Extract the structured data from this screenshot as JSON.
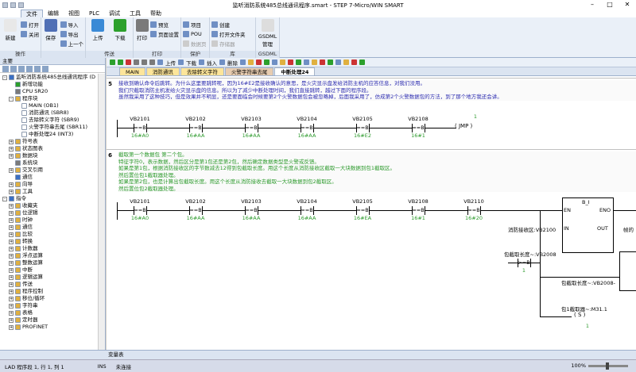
{
  "window": {
    "title": "监听消防系统485总线通讯程序.smart - STEP 7-Micro/WIN SMART",
    "controls": {
      "min": "–",
      "max": "□",
      "close": "✕"
    }
  },
  "menu": {
    "items": [
      "文件",
      "编辑",
      "视图",
      "PLC",
      "调试",
      "工具",
      "帮助"
    ],
    "active": 0
  },
  "ribbon": {
    "groups": [
      {
        "label": "操作",
        "big": [
          {
            "label": "新建",
            "icon": "new-icon",
            "color": "#e8e8e8"
          }
        ],
        "small": [
          {
            "label": "打开",
            "icon": "open-icon"
          },
          {
            "label": "关闭",
            "icon": "close-file-icon"
          }
        ]
      },
      {
        "label": "",
        "big": [
          {
            "label": "保存",
            "icon": "save-icon",
            "color": "#4f6fb5"
          }
        ],
        "small": [
          {
            "label": "导入",
            "icon": "import-icon"
          },
          {
            "label": "导出",
            "icon": "export-icon"
          },
          {
            "label": "上一个",
            "icon": "previous-icon"
          }
        ]
      },
      {
        "label": "传送",
        "big": [
          {
            "label": "上传",
            "icon": "upload-icon",
            "color": "#3a8ad6"
          },
          {
            "label": "下载",
            "icon": "download-icon",
            "color": "#2ca02c"
          }
        ],
        "small": []
      },
      {
        "label": "打印",
        "big": [
          {
            "label": "打印",
            "icon": "print-icon",
            "color": "#7a7a7a"
          }
        ],
        "small": [
          {
            "label": "预览",
            "icon": "preview-icon"
          },
          {
            "label": "页面设置",
            "icon": "page-setup-icon"
          }
        ]
      },
      {
        "label": "保护",
        "big": [],
        "small": [
          {
            "label": "项目",
            "icon": "project-icon"
          },
          {
            "label": "POU",
            "icon": "pou-icon"
          },
          {
            "label": "数据页",
            "icon": "data-page-icon",
            "disabled": true
          }
        ]
      },
      {
        "label": "库",
        "big": [],
        "small": [
          {
            "label": "创建",
            "icon": "create-icon"
          },
          {
            "label": "打开文件夹",
            "icon": "open-folder-icon"
          },
          {
            "label": "存储器",
            "icon": "memory-icon",
            "disabled": true
          }
        ]
      },
      {
        "label": "GSDML",
        "big": [
          {
            "label": "GSDML 管理",
            "icon": "gsdml-icon",
            "color": "#dddddd"
          }
        ],
        "small": []
      }
    ]
  },
  "left": {
    "header": "主要",
    "tree": [
      {
        "label": "监听消防系统485总线通讯程序 (D",
        "level": 0,
        "exp": "-",
        "color": "#3a6fc4"
      },
      {
        "label": "新增功能",
        "level": 1,
        "exp": "",
        "color": "#2ca02c"
      },
      {
        "label": "CPU SR20",
        "level": 1,
        "exp": "",
        "color": "#7a7a7a"
      },
      {
        "label": "程序块",
        "level": 1,
        "exp": "-",
        "color": "#e0b040"
      },
      {
        "label": "MAIN (OB1)",
        "level": 2,
        "exp": "",
        "color": "#ffffff"
      },
      {
        "label": "消防通讯 (SBR8)",
        "level": 2,
        "exp": "",
        "color": "#ffffff"
      },
      {
        "label": "去除转义字符 (SBR9)",
        "level": 2,
        "exp": "",
        "color": "#ffffff"
      },
      {
        "label": "火警字符串去尾 (SBR11)",
        "level": 2,
        "exp": "",
        "color": "#ffffff"
      },
      {
        "label": "中断处理24 (INT3)",
        "level": 2,
        "exp": "",
        "color": "#ffffff"
      },
      {
        "label": "符号表",
        "level": 1,
        "exp": "+",
        "color": "#e0b040"
      },
      {
        "label": "状态图表",
        "level": 1,
        "exp": "+",
        "color": "#e0b040"
      },
      {
        "label": "数据块",
        "level": 1,
        "exp": "+",
        "color": "#e0b040"
      },
      {
        "label": "系统块",
        "level": 1,
        "exp": "",
        "color": "#7a7a7a"
      },
      {
        "label": "交叉引用",
        "level": 1,
        "exp": "+",
        "color": "#e0b040"
      },
      {
        "label": "通信",
        "level": 1,
        "exp": "",
        "color": "#3a6fc4"
      },
      {
        "label": "向导",
        "level": 1,
        "exp": "+",
        "color": "#e0b040"
      },
      {
        "label": "工具",
        "level": 1,
        "exp": "+",
        "color": "#e0b040"
      },
      {
        "label": "指令",
        "level": 0,
        "exp": "-",
        "color": "#3a6fc4"
      },
      {
        "label": "收藏夹",
        "level": 1,
        "exp": "+",
        "color": "#e0b040"
      },
      {
        "label": "位逻辑",
        "level": 1,
        "exp": "+",
        "color": "#e0b040"
      },
      {
        "label": "时钟",
        "level": 1,
        "exp": "+",
        "color": "#e0b040"
      },
      {
        "label": "通信",
        "level": 1,
        "exp": "+",
        "color": "#e0b040"
      },
      {
        "label": "比较",
        "level": 1,
        "exp": "+",
        "color": "#e0b040"
      },
      {
        "label": "转换",
        "level": 1,
        "exp": "+",
        "color": "#e0b040"
      },
      {
        "label": "计数器",
        "level": 1,
        "exp": "+",
        "color": "#e0b040"
      },
      {
        "label": "浮点运算",
        "level": 1,
        "exp": "+",
        "color": "#e0b040"
      },
      {
        "label": "整数运算",
        "level": 1,
        "exp": "+",
        "color": "#e0b040"
      },
      {
        "label": "中断",
        "level": 1,
        "exp": "+",
        "color": "#e0b040"
      },
      {
        "label": "逻辑运算",
        "level": 1,
        "exp": "+",
        "color": "#e0b040"
      },
      {
        "label": "传送",
        "level": 1,
        "exp": "+",
        "color": "#e0b040"
      },
      {
        "label": "程序控制",
        "level": 1,
        "exp": "+",
        "color": "#e0b040"
      },
      {
        "label": "移位/循环",
        "level": 1,
        "exp": "+",
        "color": "#e0b040"
      },
      {
        "label": "字符串",
        "level": 1,
        "exp": "+",
        "color": "#e0b040"
      },
      {
        "label": "表格",
        "level": 1,
        "exp": "+",
        "color": "#e0b040"
      },
      {
        "label": "定时器",
        "level": 1,
        "exp": "+",
        "color": "#e0b040"
      },
      {
        "label": "PROFINET",
        "level": 1,
        "exp": "+",
        "color": "#e0b040"
      }
    ]
  },
  "editor": {
    "toolbar": [
      "上传",
      "下载",
      "插入",
      "删除"
    ],
    "tabs": [
      {
        "label": "MAIN",
        "style": "normal"
      },
      {
        "label": "消防通讯",
        "style": "normal"
      },
      {
        "label": "去除转义字符",
        "style": "normal"
      },
      {
        "label": "火警字符串去尾",
        "style": "alt"
      },
      {
        "label": "中断处理24",
        "style": "active"
      }
    ],
    "net5": {
      "num": "5",
      "comment": [
        "接收到确认命令后跳转。为什么这里要跳转呢，因为16#E2是接收确认的意思，是火灾显示盘发给消防主机的应答信息，对我们没用。",
        "我们只截取消防主机发给火灾显示盘的信息。所以为了减少中断处理时间，我们直接跳转，越过下面的程序段。",
        "虽然我采用了这种技巧，但是效果并不明显，还是要面临会时候要第2个火警数据包会被忽略掉，后面我采用了，仿成第2个火警数据包的方法，到了那个地方我还会讲。"
      ],
      "contacts": [
        {
          "addr": "VB2101",
          "op": "==B",
          "val": "16#A0"
        },
        {
          "addr": "VB2102",
          "op": "==B",
          "val": "16#AA"
        },
        {
          "addr": "VB2103",
          "op": "==B",
          "val": "16#AA"
        },
        {
          "addr": "VB2104",
          "op": "==B",
          "val": "16#AA"
        },
        {
          "addr": "VB2105",
          "op": "==B",
          "val": "16#E2"
        },
        {
          "addr": "VB2108",
          "op": "==B",
          "val": "16#1"
        }
      ],
      "coil": {
        "label": "JMP",
        "param": "1"
      }
    },
    "net6": {
      "num": "6",
      "comment": [
        "截取第一个数据包 第二个包。",
        "特征字符0，表示数据，然后区分是第1包还是第2包，然后确定数据类型是火警或反馈。",
        "如果是第1包，根据消防接收区的字节数减去12得到包截取长度。用这个长度从消防接收区截取一大块数据到包1截取区。",
        "然后置位包1截取器处理。",
        "如果是第2包，也是计算出包截取长度。用这个长度从消防接收去截取一大块数据到包2截取区。",
        "然后置位包2截取器处理。"
      ],
      "contacts": [
        {
          "addr": "VB2101",
          "op": "==B",
          "val": "16#A0"
        },
        {
          "addr": "VB2102",
          "op": "==B",
          "val": "16#AA"
        },
        {
          "addr": "VB2103",
          "op": "==B",
          "val": "16#AA"
        },
        {
          "addr": "VB2104",
          "op": "==B",
          "val": "16#AA"
        },
        {
          "addr": "VB2105",
          "op": "==B",
          "val": "16#EA"
        },
        {
          "addr": "VB2108",
          "op": "==B",
          "val": "16#1"
        },
        {
          "addr": "VB2110",
          "op": "==B",
          "val": "16#20"
        }
      ],
      "box": {
        "title": "B_I",
        "en": "EN",
        "eno": "ENO",
        "in": "IN",
        "out": "OUT",
        "in_label": "消防接收区:VB2100",
        "out_label": "帧的"
      },
      "cmp": {
        "addr": "包截取长度~:VB2008",
        "op": ">=B",
        "val": "1"
      },
      "sub_in": "包截取长度~:VB2008-",
      "coil2": {
        "addr": "包1截取器~:M31.1",
        "label": "S",
        "param": "1"
      }
    }
  },
  "bottom_panel": {
    "label": "变量表"
  },
  "status": {
    "mode": "LAD 程序段 1, 行 1, 列 1",
    "ins": "INS",
    "conn": "未连接",
    "zoom": "100%"
  }
}
